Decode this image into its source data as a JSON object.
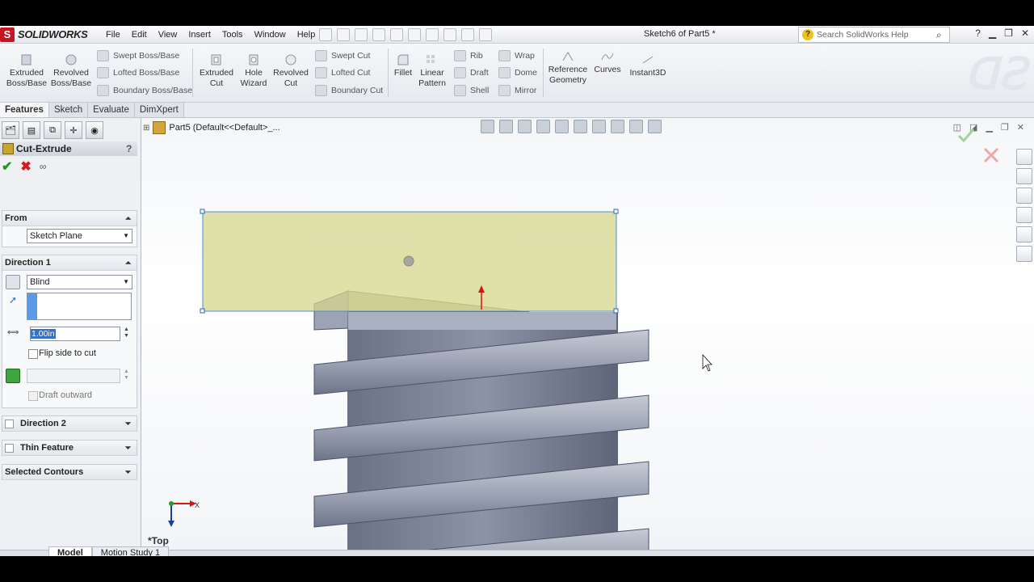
{
  "app": {
    "brand": "SOLIDWORKS",
    "brand_mark": "S",
    "doc_title": "Sketch6 of Part5 *"
  },
  "menus": [
    "File",
    "Edit",
    "View",
    "Insert",
    "Tools",
    "Window",
    "Help"
  ],
  "search": {
    "placeholder": "Search SolidWorks Help"
  },
  "command_manager": {
    "extruded_boss": [
      "Extruded",
      "Boss/Base"
    ],
    "revolved_boss": [
      "Revolved",
      "Boss/Base"
    ],
    "swept_boss": "Swept Boss/Base",
    "lofted_boss": "Lofted Boss/Base",
    "boundary_boss": "Boundary Boss/Base",
    "extruded_cut": [
      "Extruded",
      "Cut"
    ],
    "hole_wizard": [
      "Hole",
      "Wizard"
    ],
    "revolved_cut": [
      "Revolved",
      "Cut"
    ],
    "swept_cut": "Swept Cut",
    "lofted_cut": "Lofted Cut",
    "boundary_cut": "Boundary Cut",
    "fillet": "Fillet",
    "linear_pattern": [
      "Linear",
      "Pattern"
    ],
    "rib": "Rib",
    "draft": "Draft",
    "shell": "Shell",
    "wrap": "Wrap",
    "dome": "Dome",
    "mirror": "Mirror",
    "reference_geometry": [
      "Reference",
      "Geometry"
    ],
    "curves": "Curves",
    "instant3d": "Instant3D"
  },
  "tabs": [
    "Features",
    "Sketch",
    "Evaluate",
    "DimXpert"
  ],
  "property_manager": {
    "title": "Cut-Extrude",
    "help": "?",
    "from": {
      "label": "From",
      "value": "Sketch Plane"
    },
    "direction1": {
      "label": "Direction 1",
      "end_condition": "Blind",
      "depth": "1.00in",
      "flip_label": "Flip side to cut",
      "draft_label": "Draft outward"
    },
    "direction2": {
      "label": "Direction 2"
    },
    "thin_feature": {
      "label": "Thin Feature"
    },
    "selected_contours": {
      "label": "Selected Contours"
    }
  },
  "tree": {
    "part": "Part5  (Default<<Default>_..."
  },
  "view": {
    "orientation": "*Top",
    "triad_x": "X"
  },
  "bottom_tabs": [
    "Model",
    "Motion Study 1"
  ],
  "colors": {
    "sketch_fill": "#d6d58c",
    "thread": "#9ca3b4",
    "ok": "#1b9b1b",
    "cancel": "#d61a1a"
  }
}
